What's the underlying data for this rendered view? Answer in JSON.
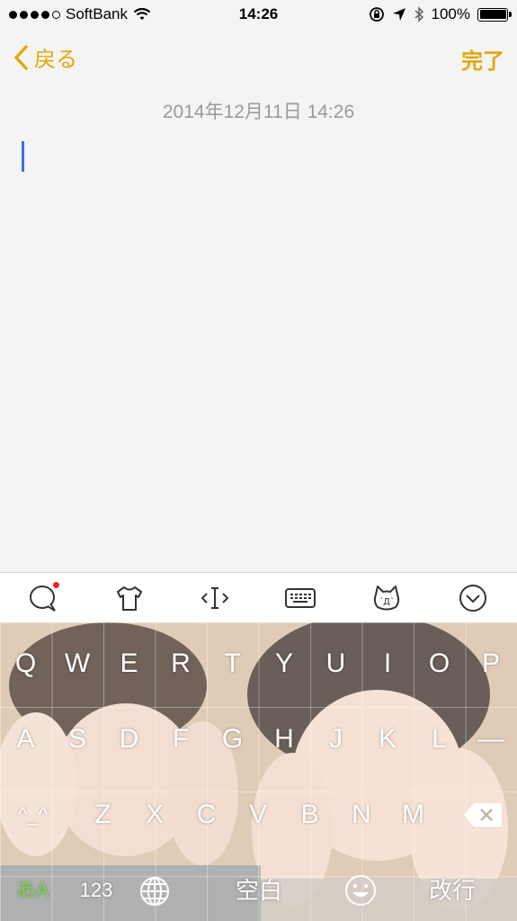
{
  "status_bar": {
    "carrier": "SoftBank",
    "time": "14:26",
    "battery_percent": "100%"
  },
  "nav": {
    "back_label": "戻る",
    "done_label": "完了"
  },
  "note": {
    "date": "2014年12月11日 14:26"
  },
  "toolbar": {
    "items": [
      "chat-bubble-icon",
      "tshirt-icon",
      "cursor-move-icon",
      "keyboard-icon",
      "cat-face-icon",
      "chevron-down-icon"
    ]
  },
  "keyboard": {
    "row1": [
      "Q",
      "W",
      "E",
      "R",
      "T",
      "Y",
      "U",
      "I",
      "O",
      "P"
    ],
    "row2": [
      "A",
      "S",
      "D",
      "F",
      "G",
      "H",
      "J",
      "K",
      "L",
      "—"
    ],
    "row3": [
      "^_^",
      "Z",
      "X",
      "C",
      "V",
      "B",
      "N",
      "M"
    ],
    "row4": {
      "lang": "あA",
      "numbers": "123",
      "space": "空白",
      "return": "改行"
    }
  },
  "colors": {
    "accent": "#e3a70d",
    "cursor": "#3b6fe0"
  }
}
